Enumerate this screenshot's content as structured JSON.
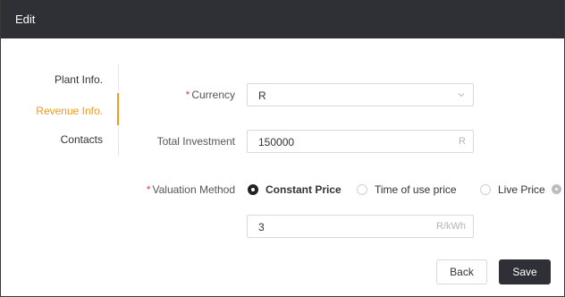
{
  "dialog": {
    "title": "Edit"
  },
  "tabs": [
    {
      "label": "Plant Info."
    },
    {
      "label": "Revenue Info."
    },
    {
      "label": "Contacts"
    }
  ],
  "form": {
    "currency": {
      "required_mark": "*",
      "label": "Currency",
      "value": "R"
    },
    "total_investment": {
      "label": "Total Investment",
      "value": "150000",
      "suffix": "R"
    },
    "valuation_method": {
      "required_mark": "*",
      "label": "Valuation Method",
      "options": [
        "Constant Price",
        "Time of use price",
        "Live Price"
      ],
      "selected": "Constant Price"
    },
    "price": {
      "value": "3",
      "suffix": "R/kWh"
    }
  },
  "buttons": {
    "back": "Back",
    "save": "Save"
  },
  "colors": {
    "header_bg": "#2f3035",
    "active_tab": "#f29a1e",
    "required": "#e0474c",
    "primary_button": "#2f3035"
  }
}
